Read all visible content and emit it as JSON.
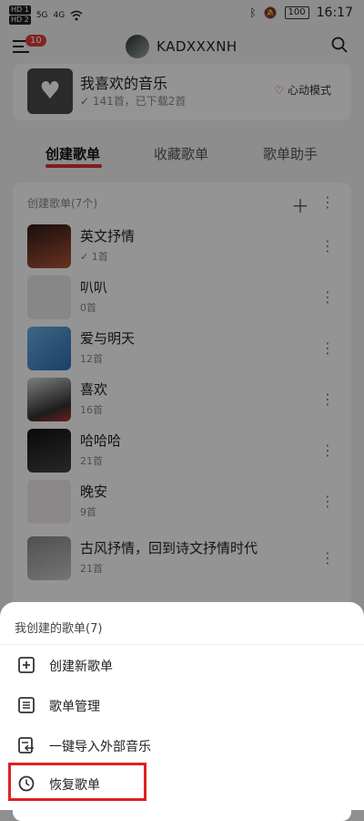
{
  "status_bar": {
    "hd1": "HD 1",
    "hd2": "HD 2",
    "net1": "5G",
    "net2": "4G",
    "battery": "100",
    "time": "16:17"
  },
  "header": {
    "badge_count": "10",
    "username": "KADXXXNH"
  },
  "favorite": {
    "title": "我喜欢的音乐",
    "subtitle": "141首，已下载2首",
    "mode_label": "心动模式"
  },
  "tabs": [
    "创建歌单",
    "收藏歌单",
    "歌单助手"
  ],
  "playlist_section": {
    "header": "创建歌单(7个)",
    "items": [
      {
        "title": "英文抒情",
        "count": "1首"
      },
      {
        "title": "叭叭",
        "count": "0首"
      },
      {
        "title": "爱与明天",
        "count": "12首"
      },
      {
        "title": "喜欢",
        "count": "16首"
      },
      {
        "title": "哈哈哈",
        "count": "21首"
      },
      {
        "title": "晚安",
        "count": "9首"
      },
      {
        "title": "古风抒情，回到诗文抒情时代",
        "count": "21首"
      }
    ]
  },
  "sheet": {
    "title": "我创建的歌单(7)",
    "options": [
      {
        "label": "创建新歌单"
      },
      {
        "label": "歌单管理"
      },
      {
        "label": "一键导入外部音乐"
      },
      {
        "label": "恢复歌单"
      }
    ]
  },
  "colors": {
    "accent": "#d33333",
    "highlight": "#d22222",
    "badge": "#e03b3b"
  }
}
